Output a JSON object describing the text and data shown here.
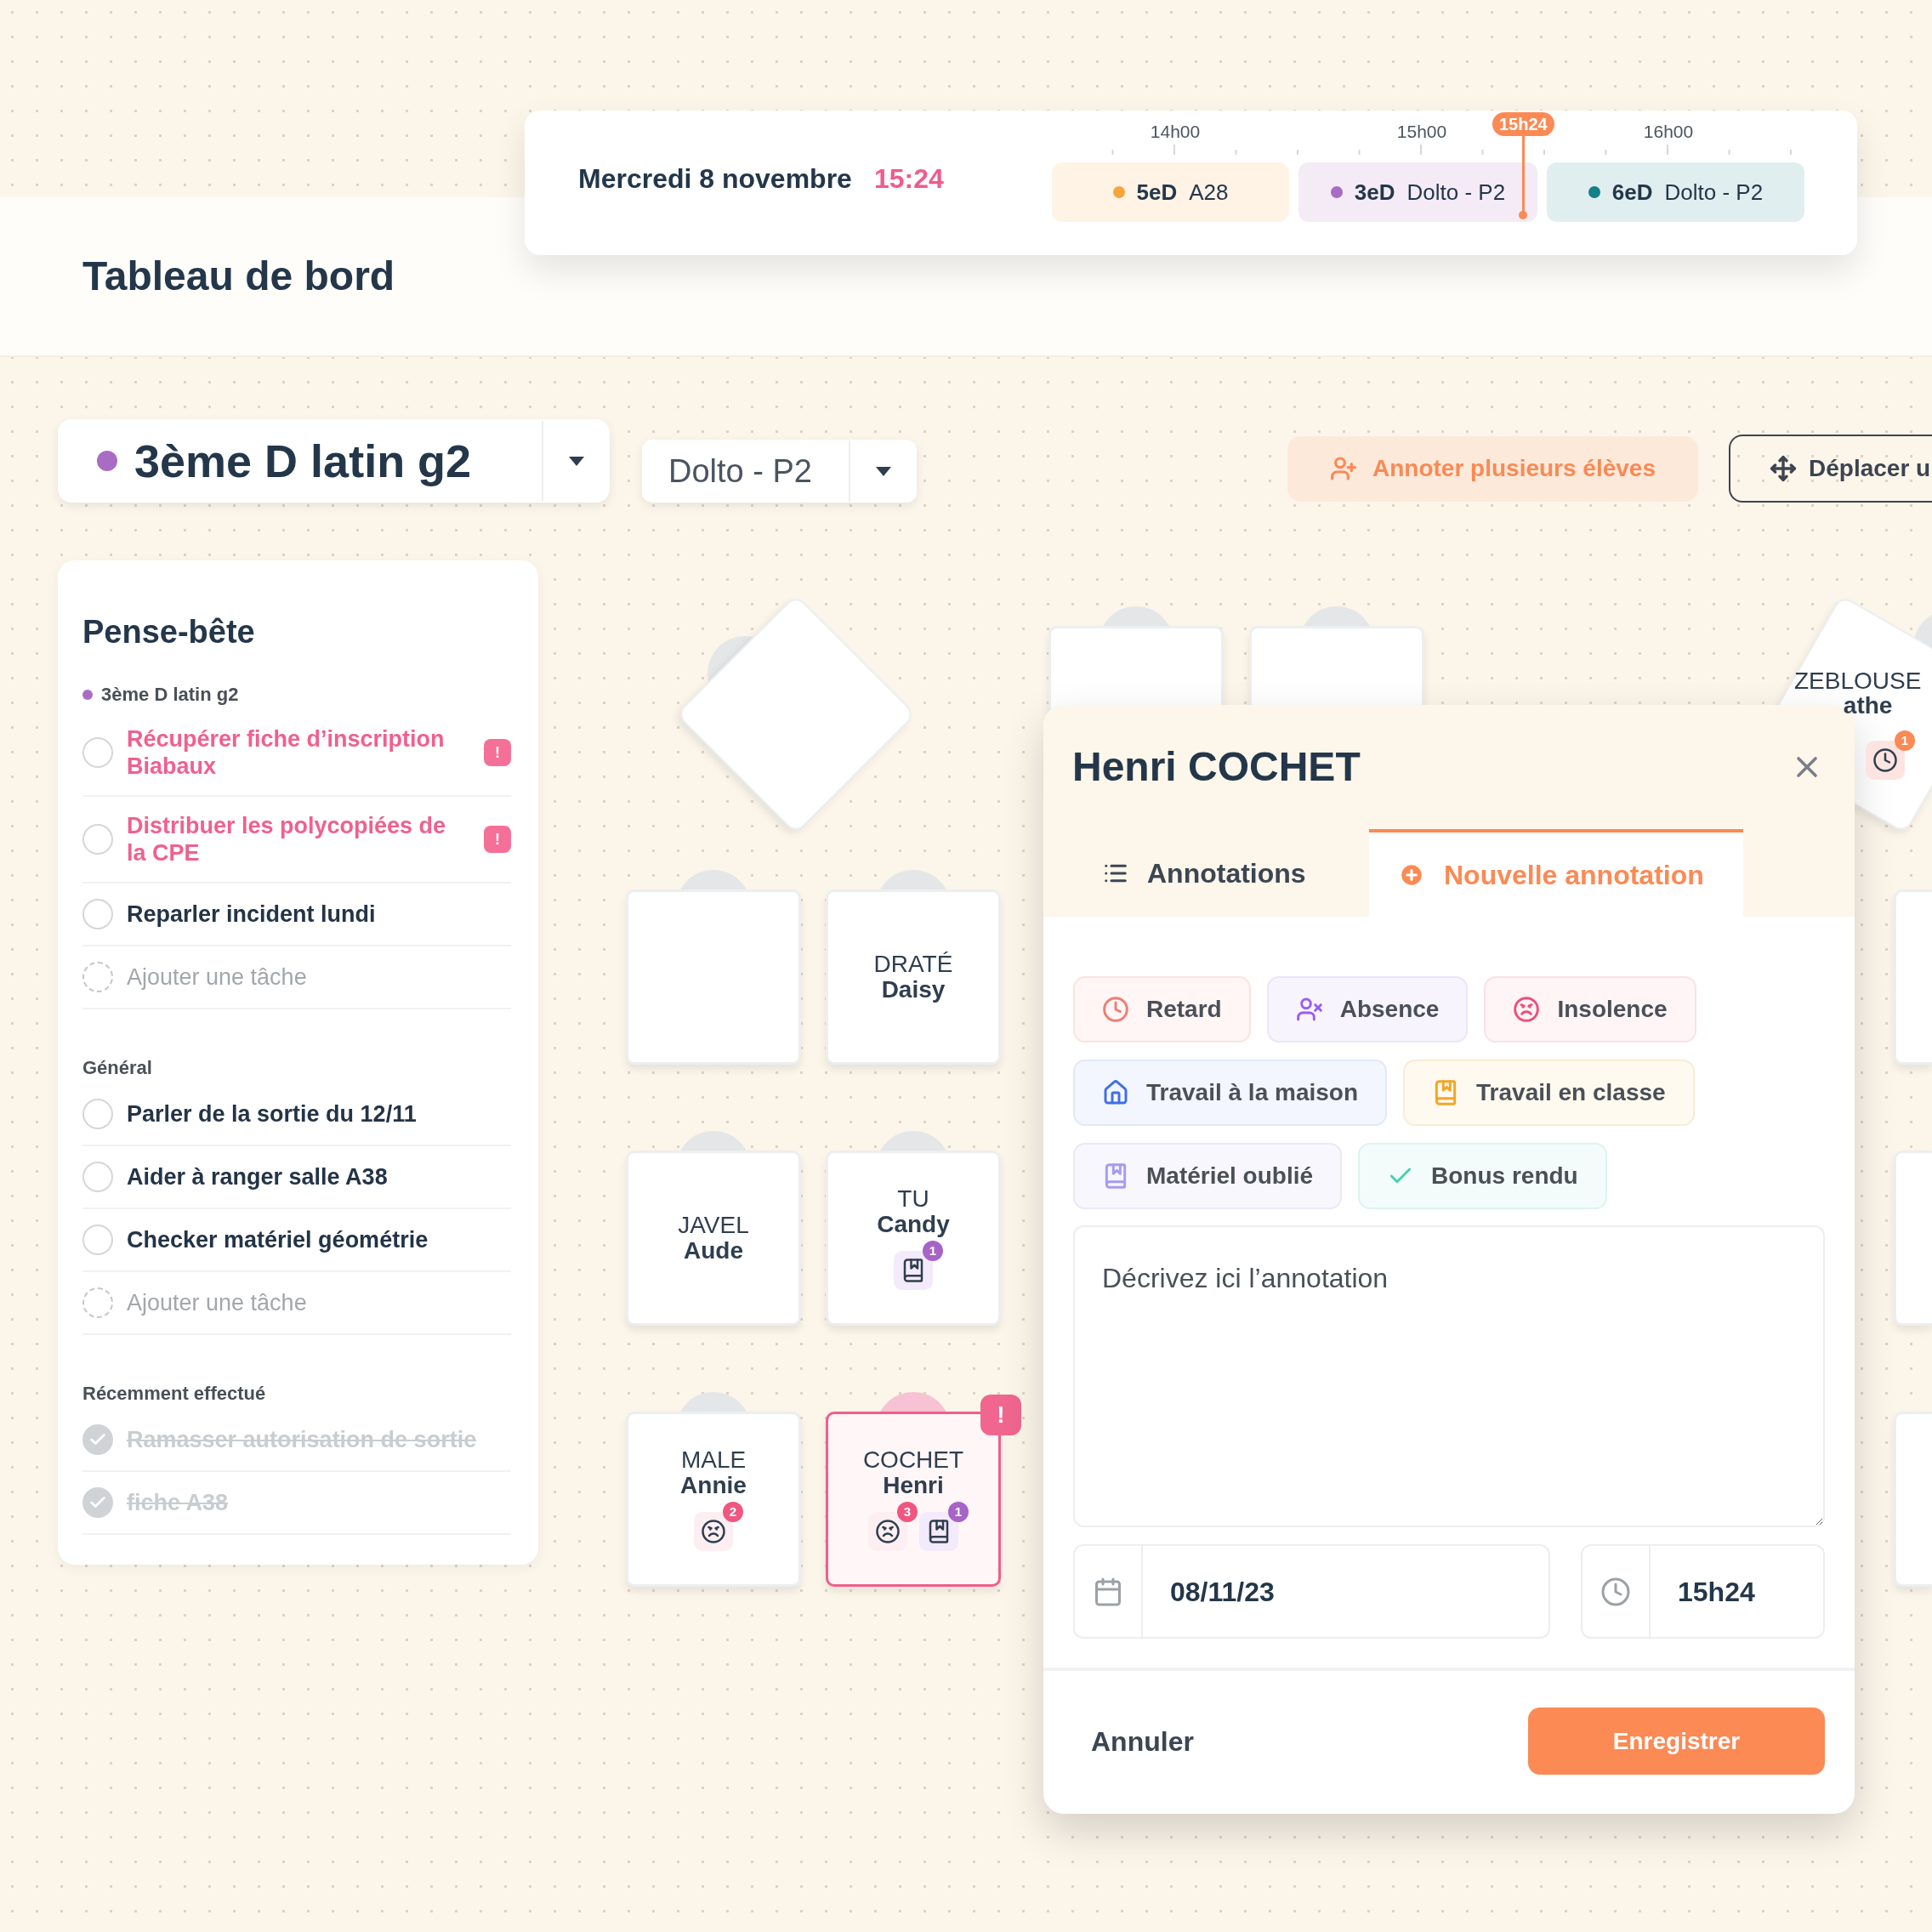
{
  "header": {
    "title": "Tableau de bord"
  },
  "schedule": {
    "date": "Mercredi 8 novembre",
    "time": "15:24",
    "hours": [
      "14h00",
      "15h00",
      "16h00"
    ],
    "now": "15h24",
    "lessons": [
      {
        "class": "5eD",
        "room": "A28",
        "color": "#f6a43c"
      },
      {
        "class": "3eD",
        "room": "Dolto - P2",
        "color": "#a96cc4"
      },
      {
        "class": "6eD",
        "room": "Dolto - P2",
        "color": "#13808a"
      }
    ]
  },
  "toolbar": {
    "class_select": {
      "label": "3ème D latin g2",
      "color": "#a96cc4"
    },
    "room_select": {
      "value": "Dolto - P2"
    },
    "buttons": [
      {
        "label": "Annoter plusieurs élèves",
        "kind": "annotate"
      },
      {
        "label": "Déplacer u",
        "kind": "move"
      }
    ]
  },
  "notes": {
    "title": "Pense-bête",
    "sections": [
      {
        "title": "3ème D latin g2",
        "color": "#a96cc4",
        "tasks": [
          {
            "kind": "task",
            "text": "Récupérer fiche d’inscription Biabaux",
            "urgent": true,
            "badge": "!",
            "done": false
          },
          {
            "kind": "task",
            "text": "Distribuer les polycopiées de la CPE",
            "urgent": true,
            "badge": "!",
            "done": false
          },
          {
            "kind": "task",
            "text": "Reparler incident lundi",
            "urgent": false,
            "done": false
          },
          {
            "kind": "add",
            "text": "Ajouter une tâche"
          }
        ]
      },
      {
        "title": "Général",
        "tasks": [
          {
            "kind": "task",
            "text": "Parler de la sortie du 12/11",
            "urgent": false,
            "done": false
          },
          {
            "kind": "task",
            "text": "Aider à ranger salle A38",
            "urgent": false,
            "done": false
          },
          {
            "kind": "task",
            "text": "Checker matériel géométrie",
            "urgent": false,
            "done": false
          },
          {
            "kind": "add",
            "text": "Ajouter une tâche"
          }
        ]
      },
      {
        "title": "Récemment effectué",
        "tasks": [
          {
            "kind": "task",
            "text": "Ramasser autorisation de sortie",
            "done": true
          },
          {
            "kind": "task",
            "text": "fiche A38",
            "done": true
          }
        ]
      }
    ]
  },
  "seating": {
    "desks": [
      {
        "kind": "diamond",
        "selected": false
      },
      {
        "kind": "square",
        "selected": false
      },
      {
        "kind": "square",
        "selected": false
      },
      {
        "kind": "square",
        "selected": false
      },
      {
        "kind": "square",
        "selected": false,
        "last_name": "DRATÉ",
        "first_name": "Daisy"
      },
      {
        "kind": "square",
        "selected": false,
        "last_name": "JAVEL",
        "first_name": "Aude"
      },
      {
        "kind": "square",
        "selected": false,
        "last_name": "TU",
        "first_name": "Candy",
        "markers": [
          {
            "kind": "material",
            "count": "1"
          }
        ]
      },
      {
        "kind": "square",
        "selected": false,
        "last_name": "MALE",
        "first_name": "Annie",
        "markers": [
          {
            "kind": "insolence",
            "count": "2"
          }
        ]
      },
      {
        "kind": "square",
        "selected": true,
        "alert": "!",
        "last_name": "COCHET",
        "first_name": "Henri",
        "markers": [
          {
            "kind": "insolence",
            "count": "3"
          },
          {
            "kind": "material",
            "count": "1"
          }
        ]
      },
      {
        "kind": "tilted",
        "selected": false,
        "last_name": "ZEBLOUSE",
        "first_name": "athe",
        "markers": [
          {
            "kind": "late",
            "count": "1"
          }
        ]
      },
      {
        "kind": "edge",
        "selected": false
      },
      {
        "kind": "edge",
        "selected": false
      },
      {
        "kind": "edge",
        "selected": false
      }
    ]
  },
  "annotation_dialog": {
    "title": "Henri COCHET",
    "tabs": [
      {
        "label": "Annotations",
        "kind": "list",
        "selected": false
      },
      {
        "label": "Nouvelle annotation",
        "kind": "new",
        "selected": true
      }
    ],
    "tag_rows": [
      [
        {
          "label": "Retard",
          "kind": "late"
        },
        {
          "label": "Absence",
          "kind": "absence"
        },
        {
          "label": "Insolence",
          "kind": "insolence"
        }
      ],
      [
        {
          "label": "Travail à la maison",
          "kind": "homework"
        },
        {
          "label": "Travail en classe",
          "kind": "classwork"
        }
      ],
      [
        {
          "label": "Matériel oublié",
          "kind": "material"
        },
        {
          "label": "Bonus rendu",
          "kind": "bonus"
        }
      ]
    ],
    "description": {
      "placeholder": "Décrivez ici l’annotation"
    },
    "date": {
      "value": "08/11/23"
    },
    "time": {
      "value": "15h24"
    },
    "cancel": "Annuler",
    "save": "Enregistrer"
  }
}
